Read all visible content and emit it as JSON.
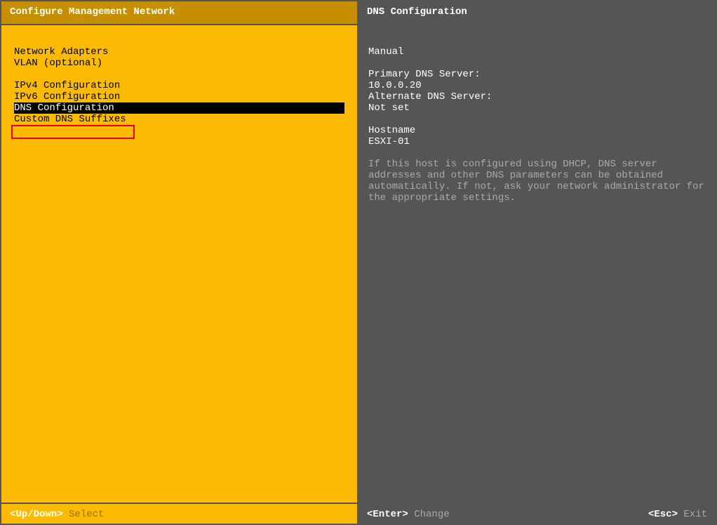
{
  "header": {
    "left_title": "Configure Management Network",
    "right_title": "DNS Configuration"
  },
  "menu": {
    "group1": [
      "Network Adapters",
      "VLAN (optional)"
    ],
    "group2": [
      "IPv4 Configuration",
      "IPv6 Configuration",
      "DNS Configuration",
      "Custom DNS Suffixes"
    ],
    "selected_index": 2
  },
  "details": {
    "mode": "Manual",
    "primary_label": "Primary DNS Server:",
    "primary_value": "10.0.0.20",
    "alternate_label": "Alternate DNS Server:",
    "alternate_value": "Not set",
    "hostname_label": "Hostname",
    "hostname_value": "ESXI-01",
    "help_text": "If this host is configured using DHCP, DNS server addresses and other DNS parameters can be obtained automatically. If not, ask your network administrator for the appropriate settings."
  },
  "footer": {
    "left_key": "<Up/Down>",
    "left_action": "Select",
    "enter_key": "<Enter>",
    "enter_action": "Change",
    "esc_key": "<Esc>",
    "esc_action": "Exit"
  }
}
